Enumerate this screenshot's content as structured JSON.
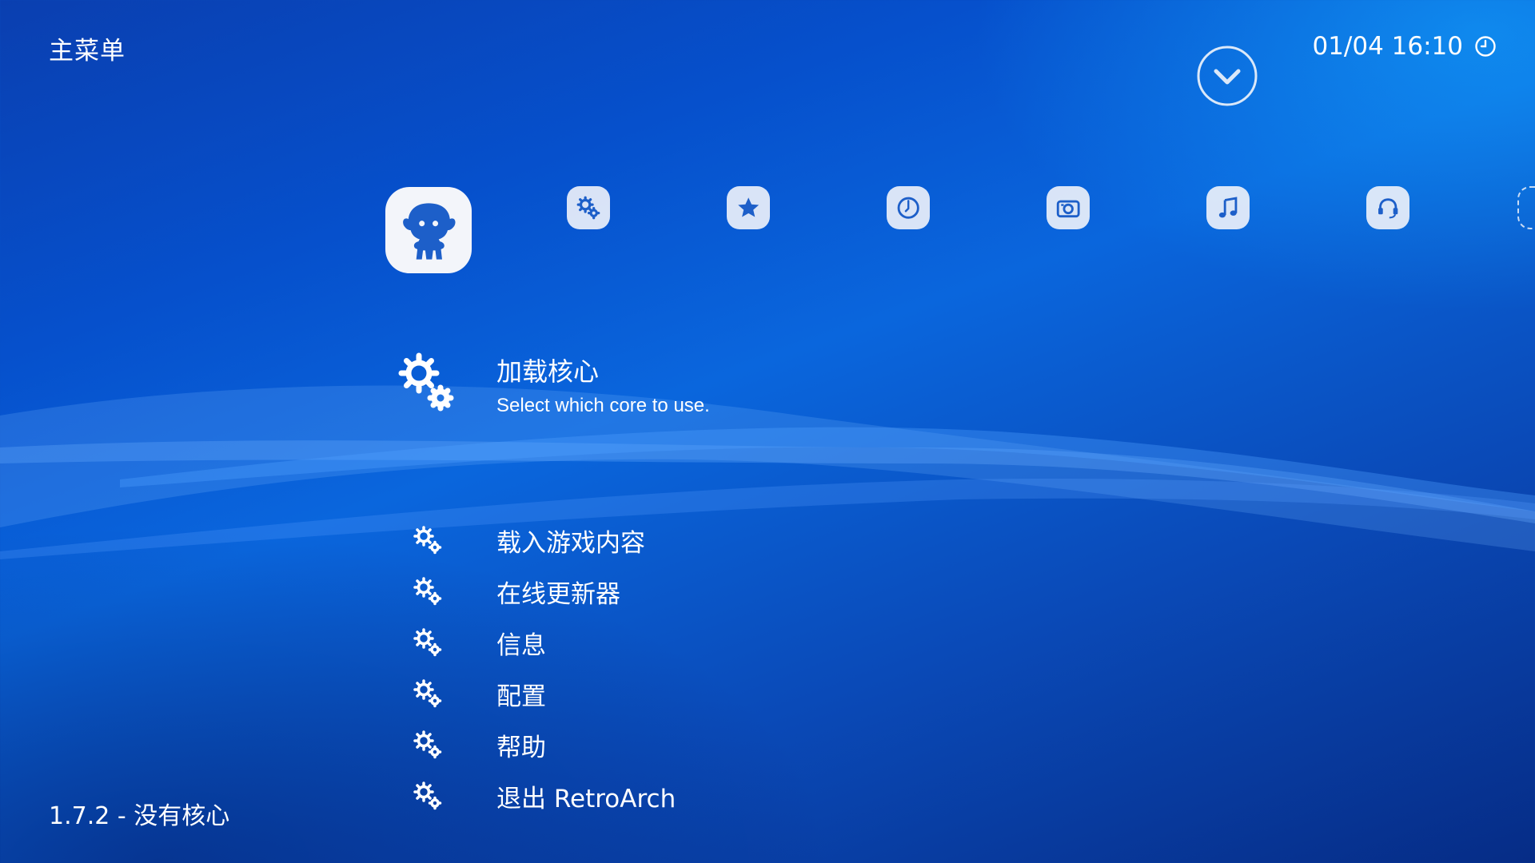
{
  "header": {
    "title": "主菜单",
    "datetime": "01/04 16:10"
  },
  "tabs": [
    {
      "id": "main-menu",
      "icon": "retroarch-mascot-icon",
      "active": true
    },
    {
      "id": "settings",
      "icon": "settings-gears-icon"
    },
    {
      "id": "favorites",
      "icon": "star-icon"
    },
    {
      "id": "history",
      "icon": "clock-icon"
    },
    {
      "id": "images",
      "icon": "camera-icon"
    },
    {
      "id": "music",
      "icon": "music-note-icon"
    },
    {
      "id": "netplay",
      "icon": "headset-icon"
    },
    {
      "id": "more",
      "icon": "partial-tab-icon"
    }
  ],
  "active_entry": {
    "label": "加载核心",
    "sublabel": "Select which core to use."
  },
  "menu": {
    "items": [
      {
        "label": "载入游戏内容"
      },
      {
        "label": "在线更新器"
      },
      {
        "label": "信息"
      },
      {
        "label": "配置"
      },
      {
        "label": "帮助"
      },
      {
        "label": "退出 RetroArch"
      }
    ]
  },
  "footer": {
    "version": "1.7.2 - 没有核心"
  },
  "colors": {
    "background_top": "#0a66dd",
    "background_bottom": "#062c86",
    "icon_tile": "#ebf0fa",
    "icon_glyph": "#1d5fc9"
  }
}
